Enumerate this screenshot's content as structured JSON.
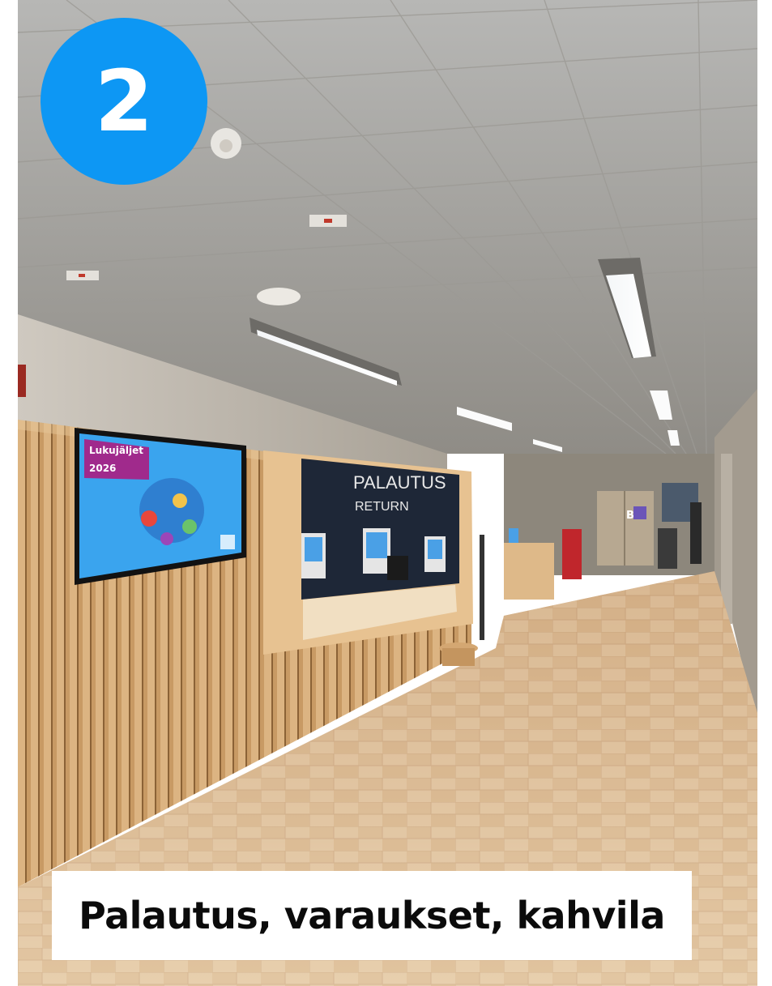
{
  "badge": {
    "number": "2",
    "color": "#0d97f4"
  },
  "caption": {
    "text": "Palautus, varaukset, kahvila"
  },
  "scene": {
    "return_sign": {
      "line1": "PALAUTUS",
      "line2": "RETURN"
    },
    "screen": {
      "title_line1": "Lukujäljet",
      "title_line2": "2026",
      "background": "#3aa4ee",
      "title_bg": "#a02a8c"
    },
    "elevator_sign": "B"
  }
}
